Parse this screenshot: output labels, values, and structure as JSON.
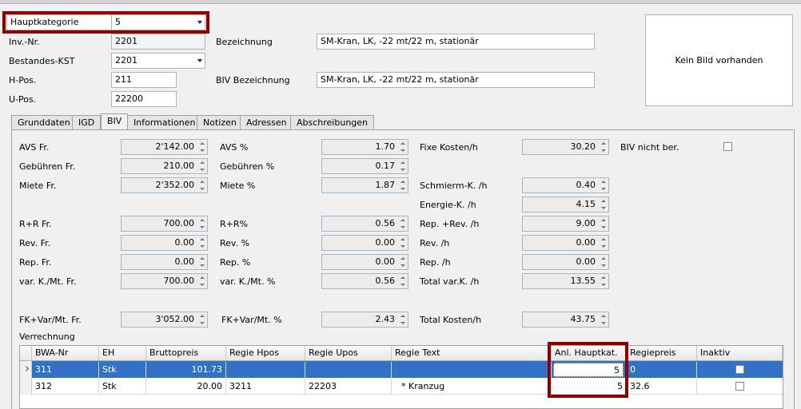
{
  "header": {
    "hauptkategorie_label": "Hauptkategorie",
    "hauptkategorie_value": "5",
    "invnr_label": "Inv.-Nr.",
    "invnr_value": "2201",
    "bestandes_label": "Bestandes-KST",
    "bestandes_value": "2201",
    "hpos_label": "H-Pos.",
    "hpos_value": "211",
    "upos_label": "U-Pos.",
    "upos_value": "22200",
    "bezeichnung_label": "Bezeichnung",
    "bezeichnung_value": "SM-Kran, LK, -22 mt/22 m, stationär",
    "biv_bez_label": "BIV Bezeichnung",
    "biv_bez_value": "SM-Kran, LK, -22 mt/22 m, stationär",
    "image_placeholder": "Kein Bild vorhanden"
  },
  "tabs": [
    "Grunddaten",
    "IGD",
    "BIV",
    "Informationen",
    "Notizen",
    "Adressen",
    "Abschreibungen"
  ],
  "biv": {
    "col1": [
      {
        "label": "AVS Fr.",
        "value": "2'142.00"
      },
      {
        "label": "Gebühren Fr.",
        "value": "210.00"
      },
      {
        "label": "Miete Fr.",
        "value": "2'352.00"
      },
      {
        "label": "R+R Fr.",
        "value": "700.00"
      },
      {
        "label": "Rev. Fr.",
        "value": "0.00"
      },
      {
        "label": "Rep. Fr.",
        "value": "0.00"
      },
      {
        "label": "var. K./Mt. Fr.",
        "value": "700.00"
      },
      {
        "label": "FK+Var/Mt. Fr.",
        "value": "3'052.00"
      }
    ],
    "col2": [
      {
        "label": "AVS %",
        "value": "1.70"
      },
      {
        "label": "Gebühren %",
        "value": "0.17"
      },
      {
        "label": "Miete %",
        "value": "1.87"
      },
      {
        "label": "R+R%",
        "value": "0.56"
      },
      {
        "label": "Rev. %",
        "value": "0.00"
      },
      {
        "label": "Rep. %",
        "value": "0.00"
      },
      {
        "label": "var. K./Mt. %",
        "value": "0.56"
      },
      {
        "label": "FK+Var/Mt. %",
        "value": "2.43"
      }
    ],
    "col3": [
      {
        "label": "Fixe Kosten/h",
        "value": "30.20"
      },
      {
        "label": "Schmierm-K. /h",
        "value": "0.40"
      },
      {
        "label": "Energie-K. /h",
        "value": "4.15"
      },
      {
        "label": "Rep. +Rev. /h",
        "value": "9.00"
      },
      {
        "label": "Rev. /h",
        "value": "0.00"
      },
      {
        "label": "Rep. /h",
        "value": "0.00"
      },
      {
        "label": "Total var.K. /h",
        "value": "13.55"
      },
      {
        "label": "Total Kosten/h",
        "value": "43.75"
      }
    ],
    "biv_nicht_ber_label": "BIV nicht ber.",
    "verrechnung_label": "Verrechnung"
  },
  "grid": {
    "columns": [
      "BWA-Nr",
      "EH",
      "Bruttopreis",
      "Regie Hpos",
      "Regie Upos",
      "Regie Text",
      "Anl. Hauptkat.",
      "Regiepreis",
      "Inaktiv"
    ],
    "rows": [
      {
        "bwa": "311",
        "eh": "Stk",
        "brutto": "101.73",
        "hpos": "",
        "upos": "",
        "text": "",
        "hauptkat": "5",
        "regiepreis": "0"
      },
      {
        "bwa": "312",
        "eh": "Stk",
        "brutto": "20.00",
        "hpos": "3211",
        "upos": "22203",
        "text": "* Kranzug",
        "hauptkat": "5",
        "regiepreis": "32.6"
      }
    ]
  },
  "colors": {
    "highlight": "#8b0000",
    "selection": "#3172c6"
  }
}
